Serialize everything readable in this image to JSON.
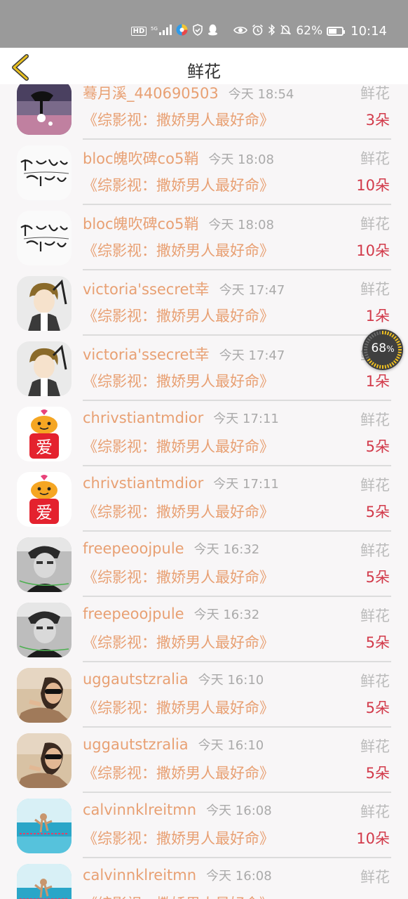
{
  "status_bar": {
    "hd": "HD",
    "net": "5G",
    "battery_percent": "62%",
    "battery_level": 0.62,
    "time": "10:14",
    "icons": [
      "hd-icon",
      "5g-signal-icon",
      "app-icon",
      "shield-icon",
      "qq-icon",
      "eye-icon",
      "alarm-icon",
      "bluetooth-icon",
      "mute-icon",
      "battery-icon"
    ]
  },
  "nav": {
    "title": "鲜花",
    "back_icon": "chevron-left-icon"
  },
  "floating_progress": {
    "label": "68",
    "unit": "%",
    "value": 0.68
  },
  "colors": {
    "accent": "#e8a073",
    "amount": "#d23a4a",
    "back": "#e9c020"
  },
  "list": [
    {
      "name": "蓦月溪_440690503",
      "time": "今天 18:54",
      "kind": "鲜花",
      "book": "《综影视：撒娇男人最好命》",
      "amount": "3朵",
      "avatar": "dark-hand"
    },
    {
      "name": "bloc魄吹碑co5鞘",
      "time": "今天 18:08",
      "kind": "鲜花",
      "book": "《综影视：撒娇男人最好命》",
      "amount": "10朵",
      "avatar": "calligraphy"
    },
    {
      "name": "bloc魄吹碑co5鞘",
      "time": "今天 18:08",
      "kind": "鲜花",
      "book": "《综影视：撒娇男人最好命》",
      "amount": "10朵",
      "avatar": "calligraphy"
    },
    {
      "name": "victoria'ssecret幸",
      "time": "今天 17:47",
      "kind": "鲜花",
      "book": "《综影视：撒娇男人最好命》",
      "amount": "1朵",
      "avatar": "anime-boy"
    },
    {
      "name": "victoria'ssecret幸",
      "time": "今天 17:47",
      "kind": "鲜花",
      "book": "《综影视：撒娇男人最好命》",
      "amount": "1朵",
      "avatar": "anime-boy"
    },
    {
      "name": "chrivstiantmdior",
      "time": "今天 17:11",
      "kind": "鲜花",
      "book": "《综影视：撒娇男人最好命》",
      "amount": "5朵",
      "avatar": "love-emoji",
      "avatar_text": "爱"
    },
    {
      "name": "chrivstiantmdior",
      "time": "今天 17:11",
      "kind": "鲜花",
      "book": "《综影视：撒娇男人最好命》",
      "amount": "5朵",
      "avatar": "love-emoji",
      "avatar_text": "爱"
    },
    {
      "name": "freepeoojpule",
      "time": "今天 16:32",
      "kind": "鲜花",
      "book": "《综影视：撒娇男人最好命》",
      "amount": "5朵",
      "avatar": "bw-portrait"
    },
    {
      "name": "freepeoojpule",
      "time": "今天 16:32",
      "kind": "鲜花",
      "book": "《综影视：撒娇男人最好命》",
      "amount": "5朵",
      "avatar": "bw-portrait"
    },
    {
      "name": "uggautstzralia",
      "time": "今天 16:10",
      "kind": "鲜花",
      "book": "《综影视：撒娇男人最好命》",
      "amount": "5朵",
      "avatar": "beach-sunglasses"
    },
    {
      "name": "uggautstzralia",
      "time": "今天 16:10",
      "kind": "鲜花",
      "book": "《综影视：撒娇男人最好命》",
      "amount": "5朵",
      "avatar": "beach-sunglasses"
    },
    {
      "name": "calvinnklreitmn",
      "time": "今天 16:08",
      "kind": "鲜花",
      "book": "《综影视：撒娇男人最好命》",
      "amount": "10朵",
      "avatar": "sea-girl"
    },
    {
      "name": "calvinnklreitmn",
      "time": "今天 16:08",
      "kind": "鲜花",
      "book": "《综影视：撒娇男人最好命》",
      "amount": "",
      "avatar": "sea-girl"
    }
  ]
}
